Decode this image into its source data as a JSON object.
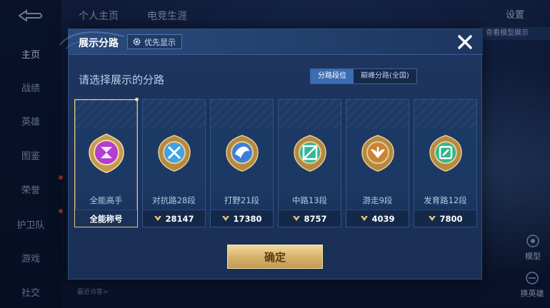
{
  "background": {
    "top_tabs": [
      "个人主页",
      "电竞生涯"
    ],
    "settings_label": "设置",
    "banner_text": "查看模型展示",
    "sidebar": [
      {
        "label": "主页",
        "active": true
      },
      {
        "label": "战绩",
        "active": false
      },
      {
        "label": "英雄",
        "active": false
      },
      {
        "label": "图鉴",
        "active": false
      },
      {
        "label": "荣誉",
        "active": false
      },
      {
        "label": "护卫队",
        "active": false
      },
      {
        "label": "游戏",
        "active": false
      },
      {
        "label": "社交",
        "active": false
      }
    ],
    "right_buttons": [
      "模型",
      "换英雄"
    ],
    "bottom_hint": "最近访客>"
  },
  "modal": {
    "title": "展示分路",
    "priority_button": "优先显示",
    "subtitle": "请选择展示的分路",
    "segments": [
      {
        "label": "分路段位",
        "active": true
      },
      {
        "label": "巅峰分路(全国)",
        "active": false
      }
    ],
    "cards": [
      {
        "lane": "全能高手",
        "value": "全能称号",
        "selected": true,
        "badge_color": "#b23fd0",
        "show_points_icon": false
      },
      {
        "lane": "对抗路28段",
        "value": "28147",
        "selected": false,
        "badge_color": "#3fa2e6",
        "show_points_icon": true
      },
      {
        "lane": "打野21段",
        "value": "17380",
        "selected": false,
        "badge_color": "#3b7ee0",
        "show_points_icon": true
      },
      {
        "lane": "中路13段",
        "value": "8757",
        "selected": false,
        "badge_color": "#2fb89a",
        "show_points_icon": true
      },
      {
        "lane": "游走9段",
        "value": "4039",
        "selected": false,
        "badge_color": "#c8843a",
        "show_points_icon": true
      },
      {
        "lane": "发育路12段",
        "value": "7800",
        "selected": false,
        "badge_color": "#2fb88a",
        "show_points_icon": true
      }
    ],
    "confirm_button": "确定"
  },
  "colors": {
    "accent_blue": "#3b6db4",
    "gold": "#d7b36c",
    "modal_bg": "#1e3660"
  }
}
